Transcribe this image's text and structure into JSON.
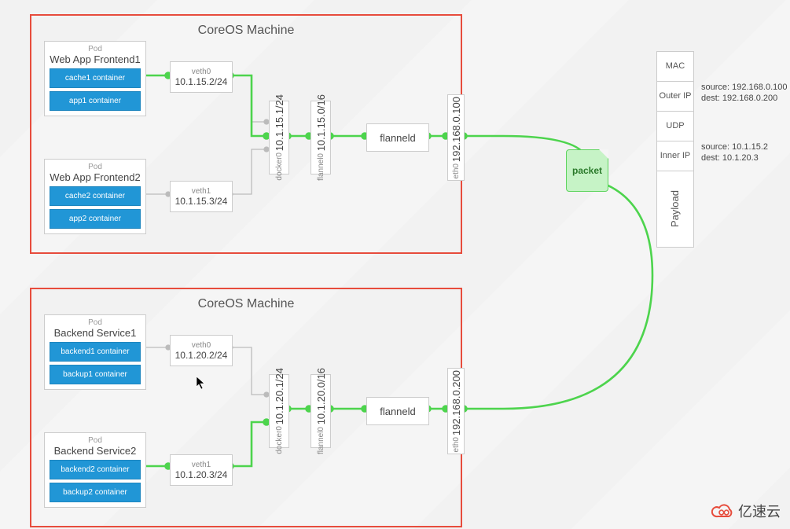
{
  "machine1": {
    "title": "CoreOS Machine",
    "pod1": {
      "label": "Pod",
      "name": "Web App Frontend1",
      "c1": "cache1 container",
      "c2": "app1 container"
    },
    "pod2": {
      "label": "Pod",
      "name": "Web App Frontend2",
      "c1": "cache2 container",
      "c2": "app2 container"
    },
    "veth0": {
      "lbl": "veth0",
      "addr": "10.1.15.2/24"
    },
    "veth1": {
      "lbl": "veth1",
      "addr": "10.1.15.3/24"
    },
    "docker0": {
      "lbl": "docker0",
      "addr": "10.1.15.1/24"
    },
    "flannel0": {
      "lbl": "flannel0",
      "addr": "10.1.15.0/16"
    },
    "flanneld": "flanneld",
    "eth0": {
      "lbl": "eth0",
      "addr": "192.168.0.100"
    }
  },
  "machine2": {
    "title": "CoreOS Machine",
    "pod1": {
      "label": "Pod",
      "name": "Backend Service1",
      "c1": "backend1 container",
      "c2": "backup1 container"
    },
    "pod2": {
      "label": "Pod",
      "name": "Backend Service2",
      "c1": "backend2 container",
      "c2": "backup2 container"
    },
    "veth0": {
      "lbl": "veth0",
      "addr": "10.1.20.2/24"
    },
    "veth1": {
      "lbl": "veth1",
      "addr": "10.1.20.3/24"
    },
    "docker0": {
      "lbl": "docker0",
      "addr": "10.1.20.1/24"
    },
    "flannel0": {
      "lbl": "flannel0",
      "addr": "10.1.20.0/16"
    },
    "flanneld": "flanneld",
    "eth0": {
      "lbl": "eth0",
      "addr": "192.168.0.200"
    }
  },
  "packet_label": "packet",
  "packet_fields": {
    "mac": "MAC",
    "outer_ip": "Outer IP",
    "udp": "UDP",
    "inner_ip": "Inner IP",
    "payload": "Payload"
  },
  "packet_outer": {
    "src": "source: 192.168.0.100",
    "dst": "dest: 192.168.0.200"
  },
  "packet_inner": {
    "src": "source: 10.1.15.2",
    "dst": "dest: 10.1.20.3"
  },
  "logo": {
    "brand_icon": "∞",
    "text": "亿速云"
  },
  "colors": {
    "accent": "#2196d6",
    "border": "#e74c3c",
    "wire": "#4dd44d"
  }
}
